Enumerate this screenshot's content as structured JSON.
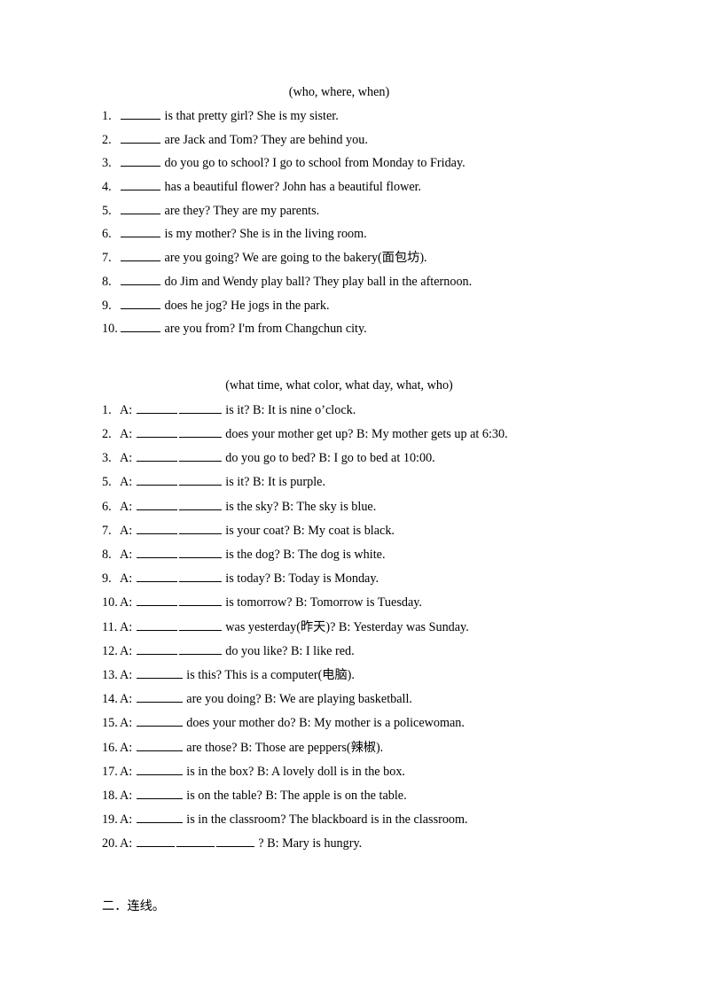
{
  "document": {
    "section1": {
      "header": "(who, where, when)",
      "items": [
        {
          "num": "1.",
          "blanks": 1,
          "text": "is that pretty girl? She is my sister."
        },
        {
          "num": "2.",
          "blanks": 1,
          "text": "are Jack and Tom? They are behind you."
        },
        {
          "num": "3.",
          "blanks": 1,
          "text": "do you go to school? I go to school from Monday to Friday."
        },
        {
          "num": "4.",
          "blanks": 1,
          "text": "has a beautiful flower? John has a beautiful flower."
        },
        {
          "num": "5.",
          "blanks": 1,
          "text": "are they? They are my parents."
        },
        {
          "num": "6.",
          "blanks": 1,
          "text": "is my mother? She is in the living room."
        },
        {
          "num": "7.",
          "blanks": 1,
          "text": "are you going? We are going to the bakery(面包坊)."
        },
        {
          "num": "8.",
          "blanks": 1,
          "text": "do Jim and Wendy play ball? They play ball in the afternoon."
        },
        {
          "num": "9.",
          "blanks": 1,
          "text": "does he jog? He jogs in the park."
        },
        {
          "num": "10.",
          "blanks": 1,
          "text": "are you from? I'm from Changchun city."
        }
      ]
    },
    "section2": {
      "header": "(what time, what color, what day, what, who)",
      "items": [
        {
          "num": "1.",
          "speaker": "A:",
          "blanks": 2,
          "text": "is it?   B: It is nine o’clock."
        },
        {
          "num": "2.",
          "speaker": "A:",
          "blanks": 2,
          "text": "does your mother get up? B: My mother gets up at 6:30."
        },
        {
          "num": "3.",
          "speaker": "A:",
          "blanks": 2,
          "text": "do you go to bed? B: I go to bed at 10:00."
        },
        {
          "num": "5.",
          "speaker": "A:",
          "blanks": 2,
          "text": "is it? B: It is purple."
        },
        {
          "num": "6.",
          "speaker": "A:",
          "blanks": 2,
          "text": "is the sky? B: The sky is blue."
        },
        {
          "num": "7.",
          "speaker": "A:",
          "blanks": 2,
          "text": "is your coat? B: My coat is black."
        },
        {
          "num": "8.",
          "speaker": "A:",
          "blanks": 2,
          "text": "is the dog? B: The dog is white."
        },
        {
          "num": "9.",
          "speaker": "A:",
          "blanks": 2,
          "text": "is today? B: Today is Monday."
        },
        {
          "num": "10.",
          "speaker": "A:",
          "blanks": 2,
          "text": "is tomorrow? B: Tomorrow is Tuesday."
        },
        {
          "num": "11.",
          "speaker": "A:",
          "blanks": 2,
          "text": "was yesterday(昨天)? B: Yesterday was Sunday."
        },
        {
          "num": "12.",
          "speaker": "A:",
          "blanks": 2,
          "text": "do you like? B: I like red."
        },
        {
          "num": "13.",
          "speaker": "A:",
          "blanks": 1,
          "text": "is this? This is a computer(电脑)."
        },
        {
          "num": "14.",
          "speaker": "A:",
          "blanks": 1,
          "text": "are you doing? B: We are playing basketball."
        },
        {
          "num": "15.",
          "speaker": "A:",
          "blanks": 1,
          "text": "does your mother do? B: My mother is a policewoman."
        },
        {
          "num": "16.",
          "speaker": "A:",
          "blanks": 1,
          "text": "are those? B: Those are peppers(辣椒)."
        },
        {
          "num": "17.",
          "speaker": "A:",
          "blanks": 1,
          "text": "is in the box? B: A lovely doll is in the box."
        },
        {
          "num": "18.",
          "speaker": "A:",
          "blanks": 1,
          "text": "is on the table? B: The apple is on the table."
        },
        {
          "num": "19.",
          "speaker": "A:",
          "blanks": 1,
          "text": "is in the classroom? The blackboard is in the classroom."
        },
        {
          "num": "20.",
          "speaker": "A:",
          "blanks": 3,
          "text": "? B: Mary is hungry."
        }
      ]
    },
    "footer": {
      "text": "二．连线。"
    }
  }
}
